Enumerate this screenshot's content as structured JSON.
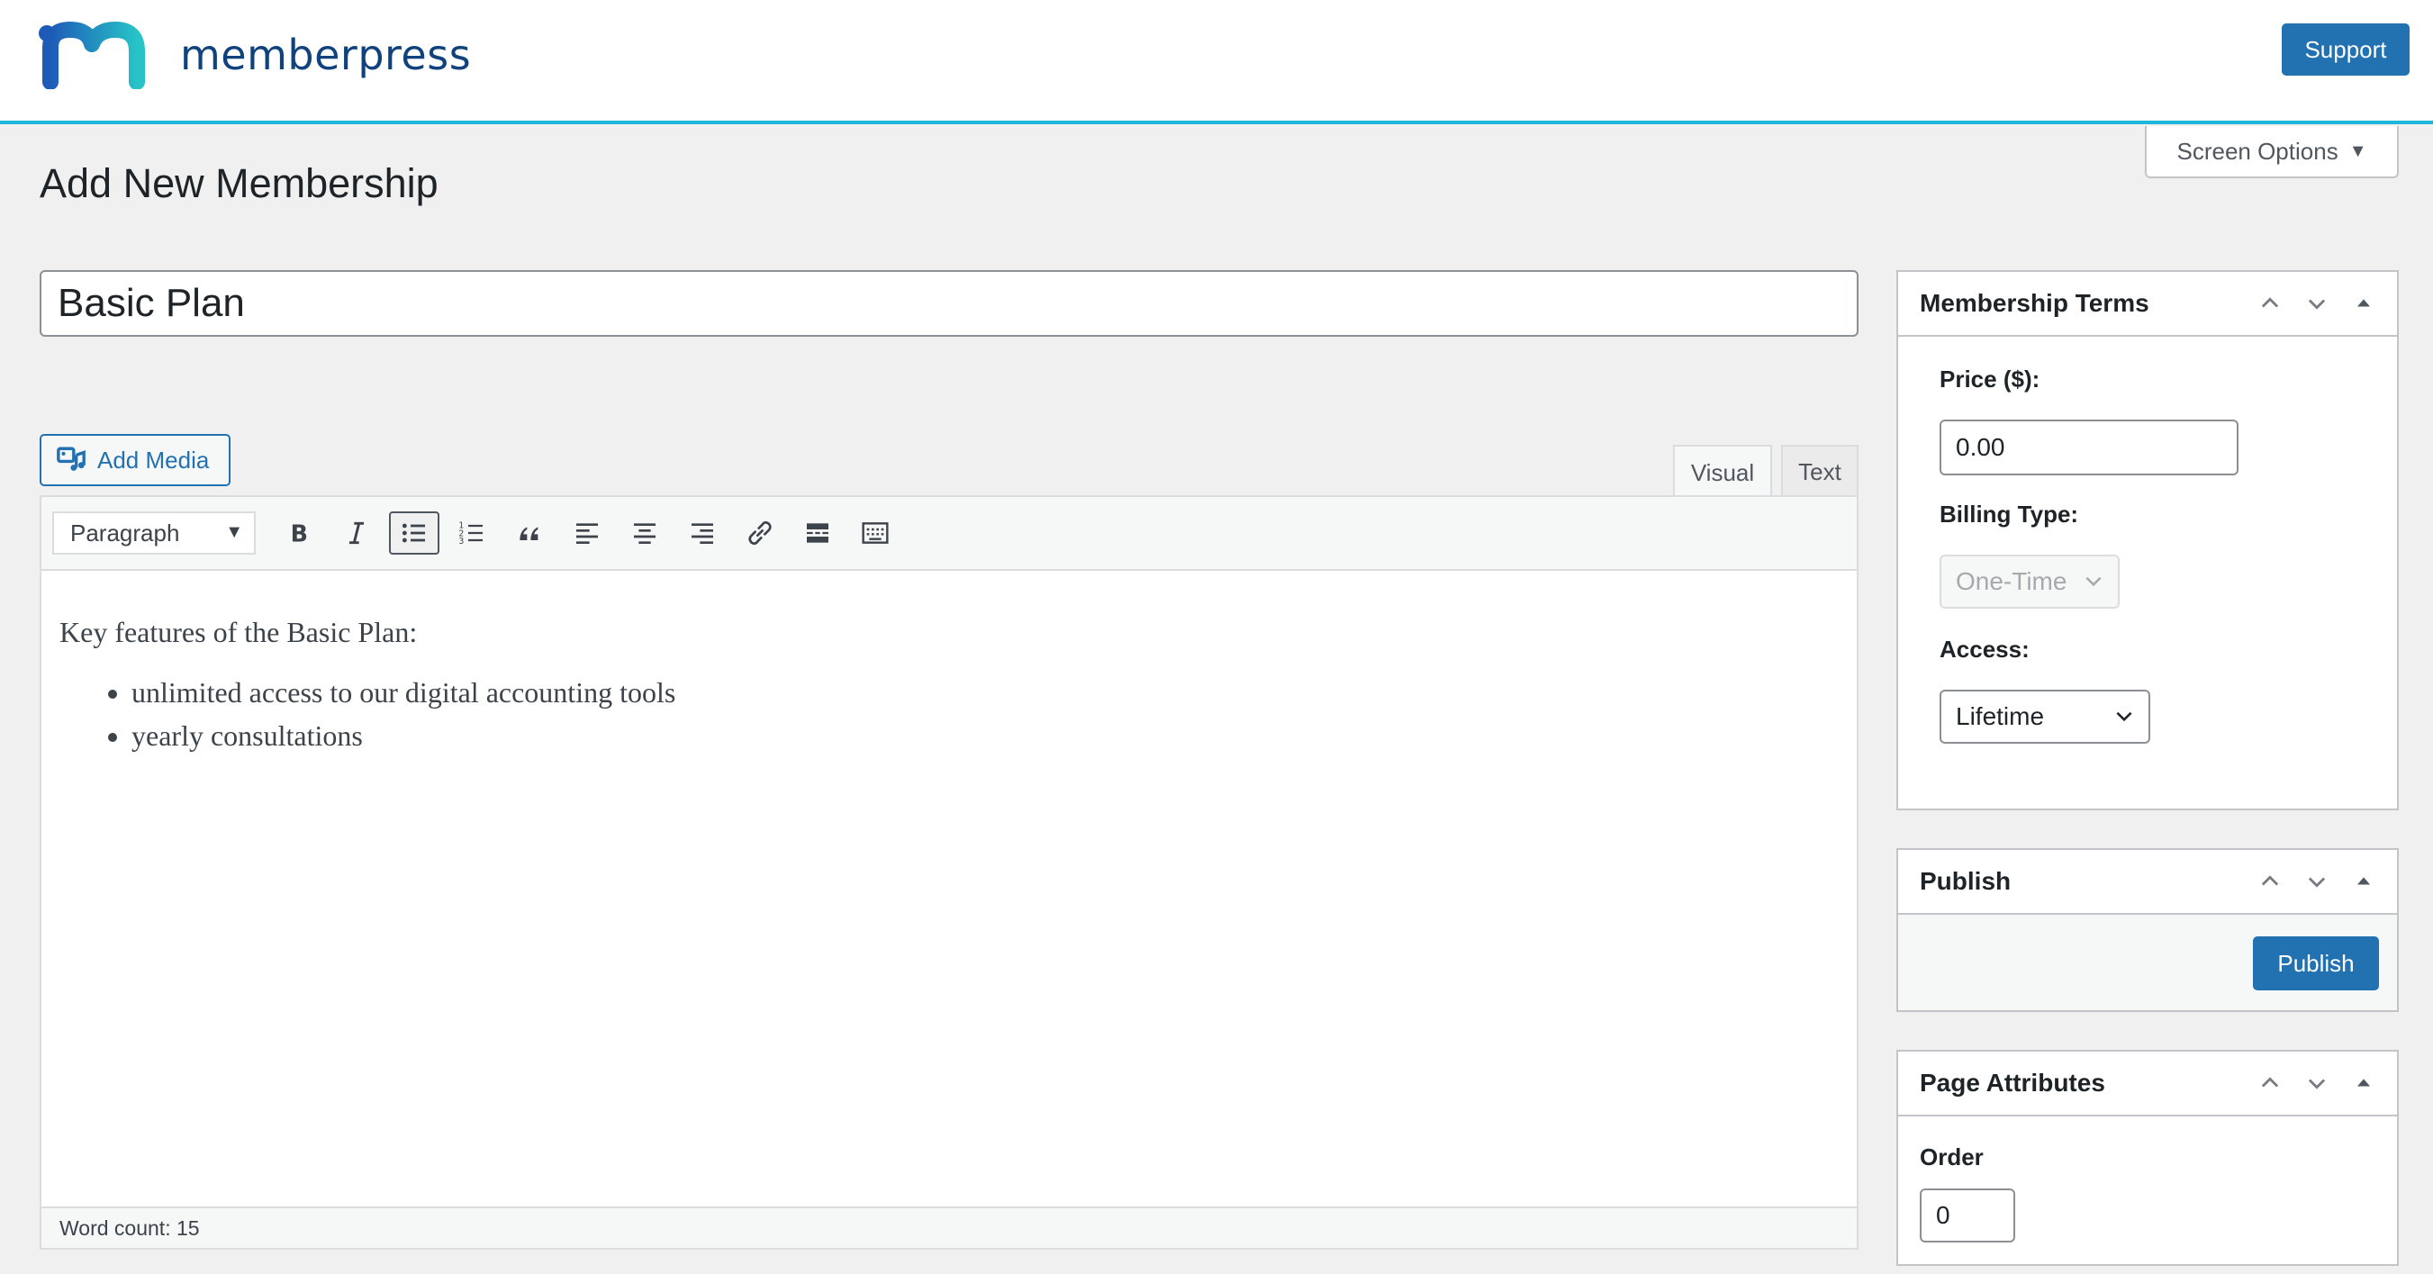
{
  "header": {
    "logo_text": "memberpress",
    "support_label": "Support"
  },
  "screen_options": {
    "label": "Screen Options"
  },
  "page": {
    "title": "Add New Membership"
  },
  "title_field": {
    "value": "Basic Plan"
  },
  "editor": {
    "add_media_label": "Add Media",
    "tabs": {
      "visual": "Visual",
      "text": "Text"
    },
    "format_select": "Paragraph",
    "intro": "Key features of the Basic Plan:",
    "bullets": [
      "unlimited access to our digital accounting tools",
      "yearly consultations"
    ],
    "word_count": "Word count: 15"
  },
  "membership_terms": {
    "title": "Membership Terms",
    "price_label": "Price ($):",
    "price_value": "0.00",
    "billing_label": "Billing Type:",
    "billing_value": "One-Time",
    "access_label": "Access:",
    "access_value": "Lifetime"
  },
  "publish_box": {
    "title": "Publish",
    "button_label": "Publish"
  },
  "page_attributes": {
    "title": "Page Attributes",
    "order_label": "Order",
    "order_value": "0"
  },
  "colors": {
    "accent": "#2271b1",
    "header_border": "#1fb6dc",
    "logo_text": "#10437e"
  }
}
